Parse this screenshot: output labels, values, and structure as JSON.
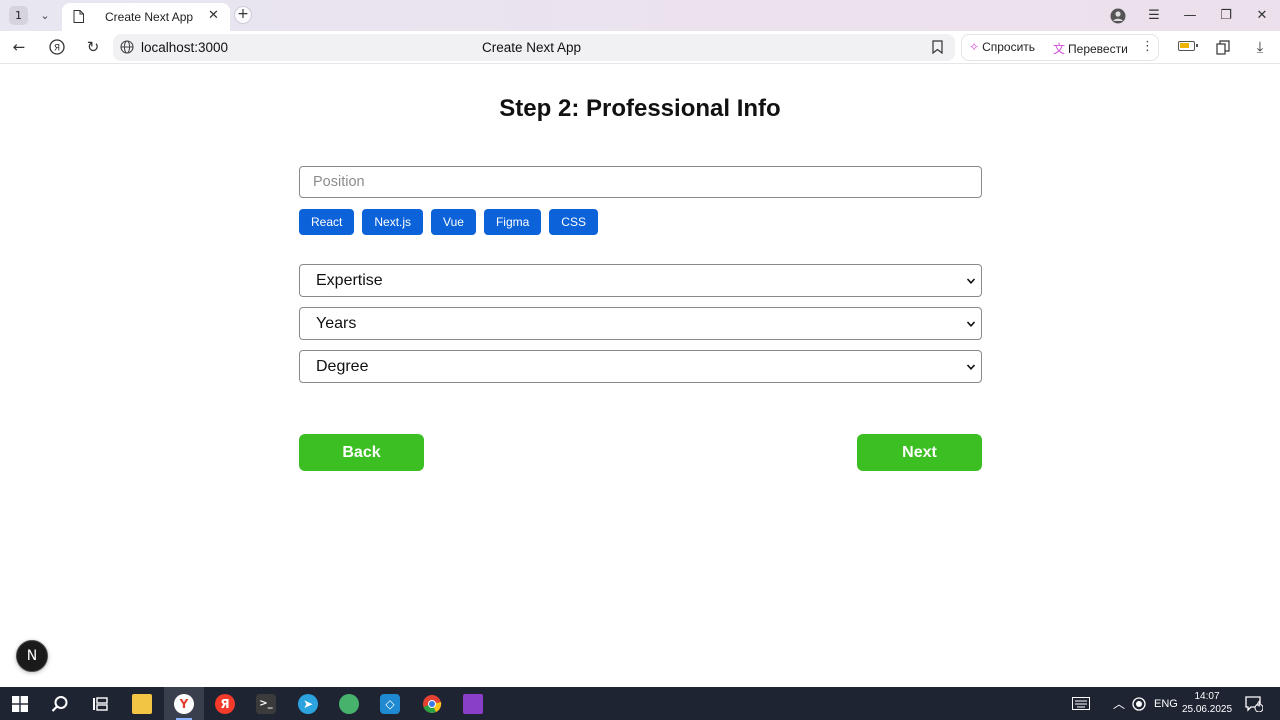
{
  "browser": {
    "tab_count": "1",
    "tab_title": "Create Next App",
    "url": "localhost:3000",
    "page_title": "Create Next App",
    "ext_ask_label": "Спросить",
    "ext_translate_label": "Перевести"
  },
  "page": {
    "heading": "Step 2: Professional Info",
    "position_placeholder": "Position",
    "skills": [
      "React",
      "Next.js",
      "Vue",
      "Figma",
      "CSS"
    ],
    "expertise_select": "Expertise",
    "years_select": "Years",
    "degree_select": "Degree",
    "back_label": "Back",
    "next_label": "Next",
    "devtools_badge": "N"
  },
  "taskbar": {
    "language": "ENG",
    "time": "14:07",
    "date": "25.06.2025",
    "notification_count": "4"
  },
  "colors": {
    "tag_blue": "#0b62d9",
    "button_green": "#3cbf23"
  }
}
